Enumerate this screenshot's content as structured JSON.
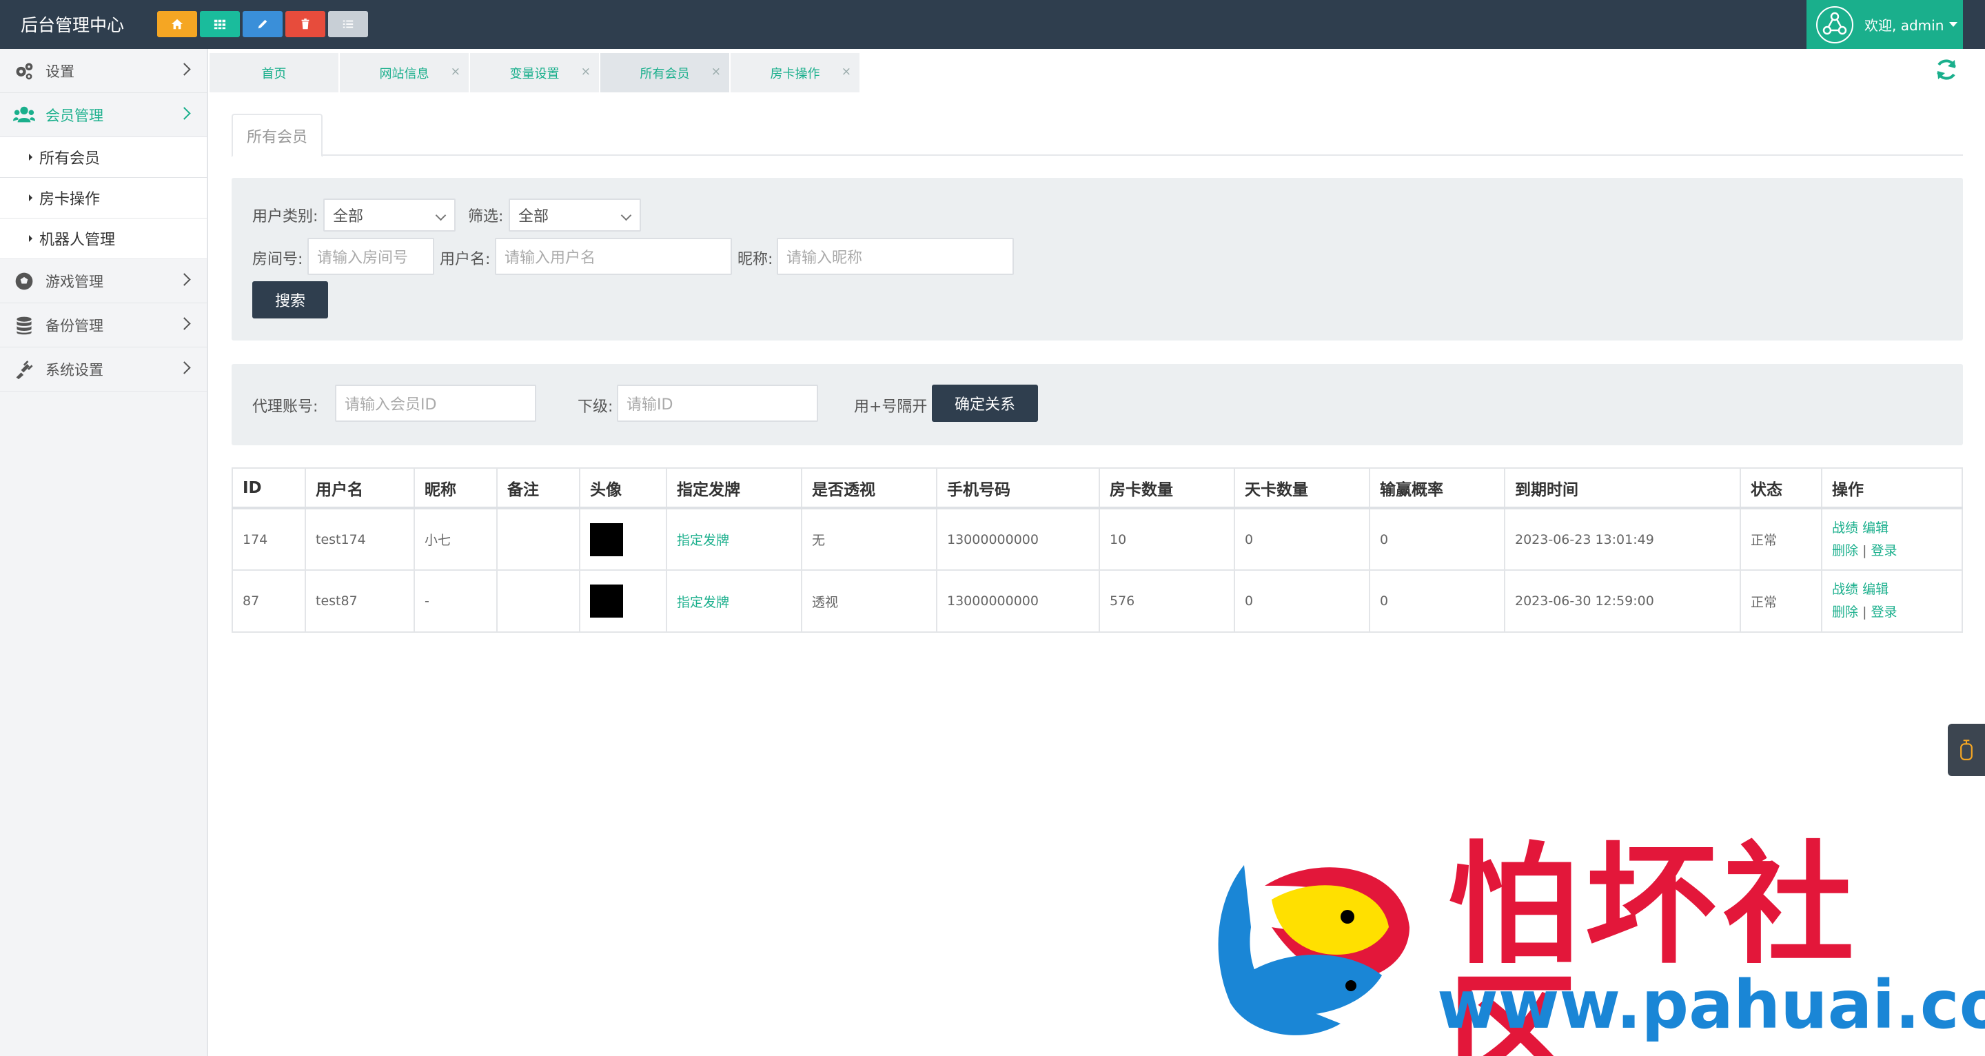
{
  "topbar": {
    "brand": "后台管理中心",
    "quick_buttons": [
      {
        "icon": "home-icon",
        "color": "#f5a623"
      },
      {
        "icon": "grid-icon",
        "color": "#1abc9c"
      },
      {
        "icon": "pencil-icon",
        "color": "#3a8fd9"
      },
      {
        "icon": "trash-icon",
        "color": "#e74c3c"
      },
      {
        "icon": "list-icon",
        "color": "#c8cfd6"
      }
    ],
    "user_label": "欢迎, admin"
  },
  "sidebar": {
    "items": [
      {
        "label": "设置",
        "icon": "gears-icon"
      },
      {
        "label": "会员管理",
        "icon": "users-icon",
        "active": true,
        "children": [
          {
            "label": "所有会员"
          },
          {
            "label": "房卡操作"
          },
          {
            "label": "机器人管理"
          }
        ]
      },
      {
        "label": "游戏管理",
        "icon": "soccer-ball-icon"
      },
      {
        "label": "备份管理",
        "icon": "database-icon"
      },
      {
        "label": "系统设置",
        "icon": "plug-icon"
      }
    ]
  },
  "tabs": [
    {
      "label": "首页",
      "closable": false
    },
    {
      "label": "网站信息",
      "closable": true
    },
    {
      "label": "变量设置",
      "closable": true
    },
    {
      "label": "所有会员",
      "closable": true,
      "current": true
    },
    {
      "label": "房卡操作",
      "closable": true
    }
  ],
  "page": {
    "tab_title": "所有会员"
  },
  "filters": {
    "user_type_label": "用户类别:",
    "user_type_value": "全部",
    "filter_label": "筛选:",
    "filter_value": "全部",
    "room_label": "房间号:",
    "room_placeholder": "请输入房间号",
    "username_label": "用户名:",
    "username_placeholder": "请输入用户名",
    "nickname_label": "昵称:",
    "nickname_placeholder": "请输入昵称",
    "search_button": "搜索"
  },
  "agent": {
    "agent_label": "代理账号:",
    "agent_placeholder": "请输入会员ID",
    "sub_label": "下级:",
    "sub_placeholder": "请输ID",
    "hint": "用+号隔开",
    "confirm_button": "确定关系"
  },
  "table": {
    "headers": [
      "ID",
      "用户名",
      "昵称",
      "备注",
      "头像",
      "指定发牌",
      "是否透视",
      "手机号码",
      "房卡数量",
      "天卡数量",
      "输赢概率",
      "到期时间",
      "状态",
      "操作"
    ],
    "rows": [
      {
        "id": "174",
        "username": "test174",
        "nickname": "小七",
        "remark": "",
        "deal": "指定发牌",
        "perspective": "无",
        "phone": "13000000000",
        "room_cards": "10",
        "day_cards": "0",
        "win_rate": "0",
        "expire": "2023-06-23 13:01:49",
        "status": "正常"
      },
      {
        "id": "87",
        "username": "test87",
        "nickname": "-",
        "remark": "",
        "deal": "指定发牌",
        "perspective": "透视",
        "phone": "13000000000",
        "room_cards": "576",
        "day_cards": "0",
        "win_rate": "0",
        "expire": "2023-06-30 12:59:00",
        "status": "正常"
      }
    ],
    "ops": {
      "record": "战绩",
      "edit": "编辑",
      "delete": "删除",
      "sep": "|",
      "login": "登录"
    }
  },
  "watermark": {
    "title": "怕坏社区",
    "url": "www.pahuai.com"
  }
}
